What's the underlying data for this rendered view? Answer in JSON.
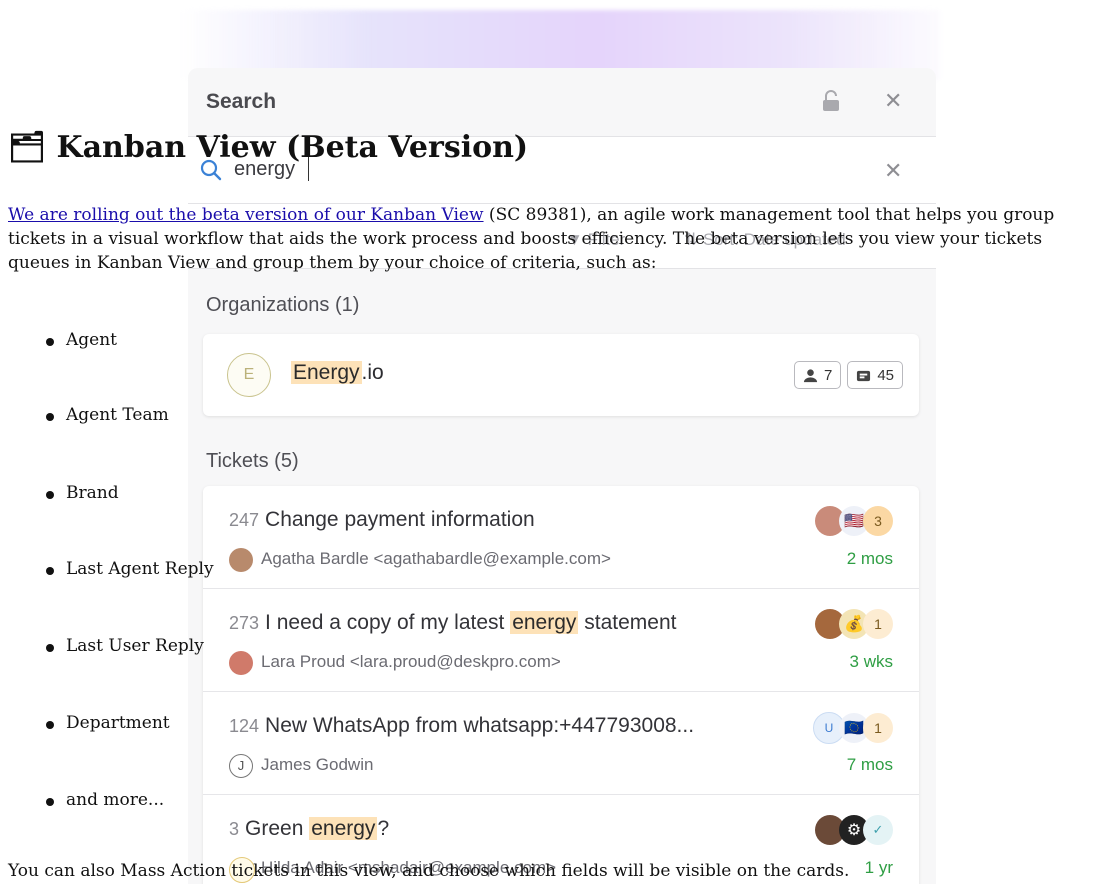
{
  "search_panel": {
    "title": "Search",
    "close_icon": "close-icon",
    "lock_icon": "lock-icon",
    "query": "energy",
    "toolbar": {
      "filter_label": "Filter",
      "sort_label": "Sort: Date updated"
    },
    "organizations": {
      "heading": "Organizations (1)",
      "items": [
        {
          "initial": "E",
          "name_highlight": "Energy",
          "name_rest": ".io",
          "people_count": "7",
          "tickets_count": "45"
        }
      ]
    },
    "tickets": {
      "heading": "Tickets (5)",
      "items": [
        {
          "id": "247",
          "subject_before": "Change payment information",
          "highlight": "",
          "subject_after": "",
          "requester": "Agatha Bardle <agathabardle@example.com>",
          "age": "2 mos",
          "count": "3"
        },
        {
          "id": "273",
          "subject_before": "I need a copy of my latest ",
          "highlight": "energy",
          "subject_after": " statement",
          "requester": "Lara Proud <lara.proud@deskpro.com>",
          "age": "3 wks",
          "count": "1"
        },
        {
          "id": "124",
          "subject_before": "New WhatsApp from whatsapp:+447793008...",
          "highlight": "",
          "subject_after": "",
          "requester": "James Godwin",
          "requester_initial": "J",
          "age": "7 mos",
          "count": "1",
          "agent_initial": "U"
        },
        {
          "id": "3",
          "subject_before": "Green ",
          "highlight": "energy",
          "subject_after": "?",
          "requester": "Hilda Adair <mshadair@example.com>",
          "age": "1 yr",
          "status": "✓"
        }
      ]
    }
  },
  "article": {
    "title": "🗂 Kanban View (Beta Version)",
    "intro_link": "We are rolling out the beta version of our Kanban View",
    "intro_rest": " (SC 89381), an agile work management tool that helps you group tickets in a visual workflow that aids the work process and boosts efficiency. The beta version lets you view your tickets queues in Kanban View and group them by your choice of criteria, such as:",
    "criteria": [
      "Agent",
      "Agent Team",
      "Brand",
      "Last Agent Reply",
      "Last User Reply",
      "Department",
      "and more..."
    ],
    "outro": "You can also Mass Action tickets in this view, and choose which fields will be visible on the cards."
  },
  "colors": {
    "highlight": "#fde2b8",
    "age_green": "#2f9e44",
    "link": "#1a0dab"
  }
}
